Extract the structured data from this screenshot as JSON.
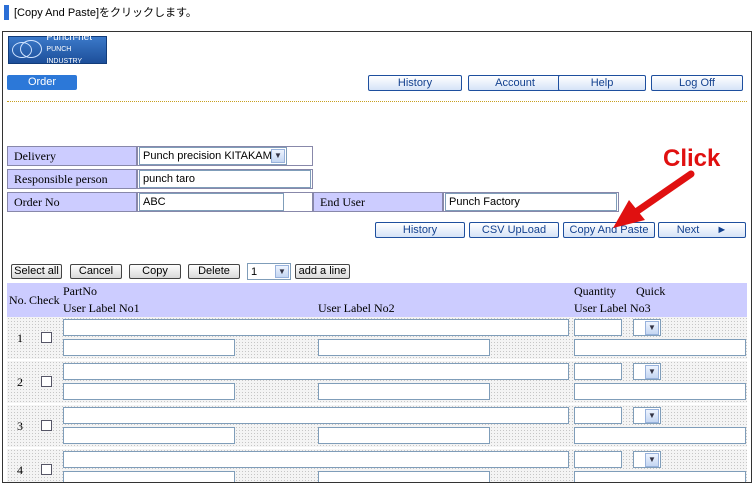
{
  "caption": "[Copy And Paste]をクリックします。",
  "logo": {
    "line1": "Punch-net",
    "line2": "PUNCH INDUSTRY"
  },
  "nav": {
    "order": "Order",
    "history": "History",
    "account": "Account",
    "help": "Help",
    "logoff": "Log Off"
  },
  "form": {
    "delivery_label": "Delivery",
    "delivery_value": "Punch precision KITAKAMI",
    "responsible_label": "Responsible person",
    "responsible_value": "punch taro",
    "orderno_label": "Order No",
    "orderno_value": "ABC",
    "enduser_label": "End User",
    "enduser_value": "Punch Factory"
  },
  "actions": {
    "history": "History",
    "csv": "CSV UpLoad",
    "copy_paste": "Copy And Paste",
    "next": "Next",
    "next_arrow": "►"
  },
  "annotation": {
    "click": "Click",
    "color": "#e01010"
  },
  "toolbar": {
    "select_all": "Select all",
    "cancel": "Cancel",
    "copy": "Copy",
    "delete": "Delete",
    "count": "1",
    "add_line": "add a line"
  },
  "grid": {
    "headers": {
      "no": "No.",
      "check": "Check",
      "partno": "PartNo",
      "label1": "User Label No1",
      "label2": "User Label No2",
      "quantity": "Quantity",
      "quick": "Quick",
      "label3": "User Label No3"
    },
    "rows": [
      {
        "no": "1"
      },
      {
        "no": "2"
      },
      {
        "no": "3"
      },
      {
        "no": "4"
      }
    ]
  }
}
